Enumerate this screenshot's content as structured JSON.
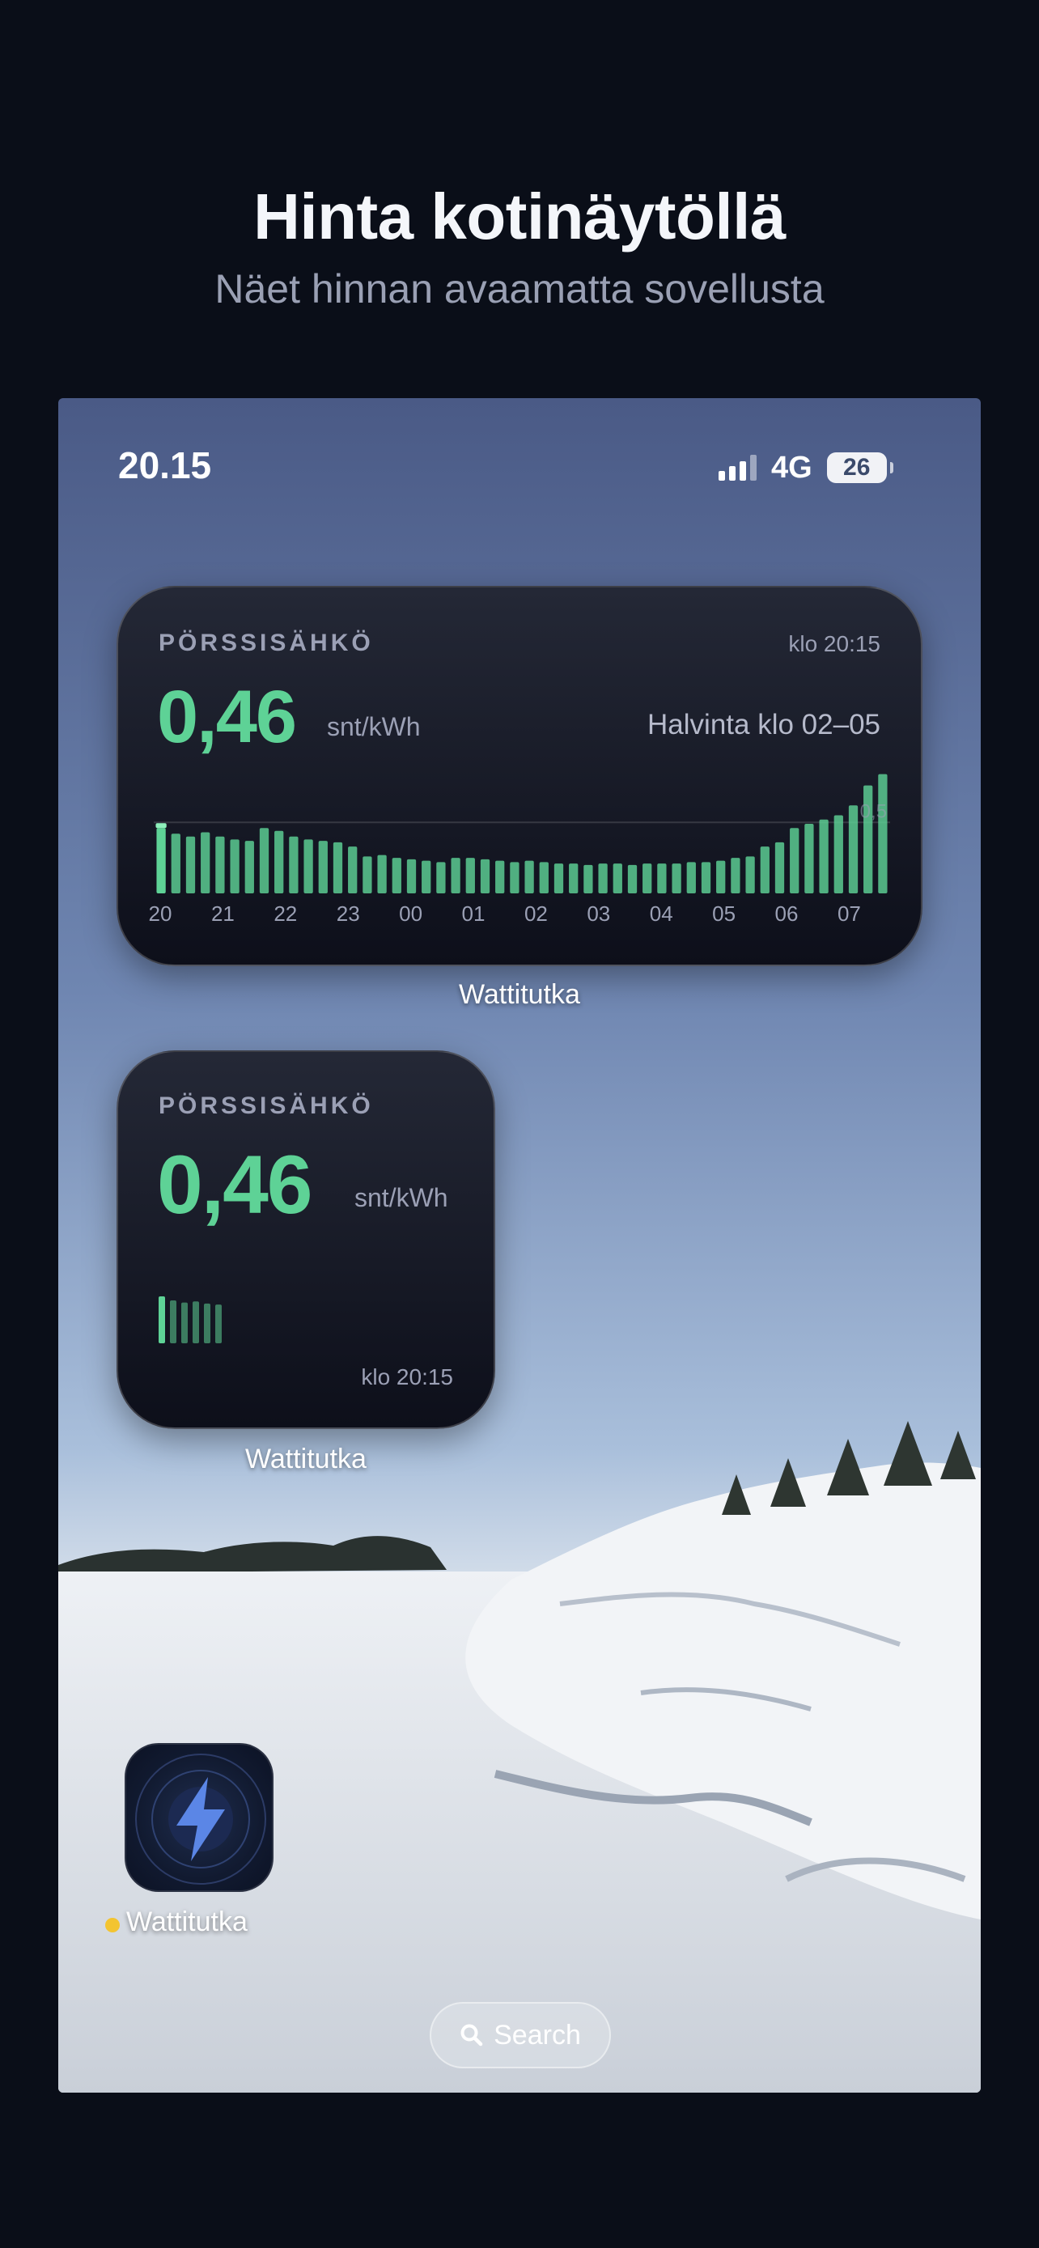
{
  "hero": {
    "title": "Hinta kotinäytöllä",
    "subtitle": "Näet hinnan avaamatta sovellusta"
  },
  "status_bar": {
    "time": "20.15",
    "network": "4G",
    "battery": "26"
  },
  "widget_large": {
    "label": "PÖRSSISÄHKÖ",
    "time": "klo 20:15",
    "price": "0,46",
    "unit": "snt/kWh",
    "cheapest": "Halvinta klo 02–05",
    "app_name": "Wattitutka"
  },
  "widget_small": {
    "label": "PÖRSSISÄHKÖ",
    "price": "0,46",
    "unit": "snt/kWh",
    "time": "klo 20:15",
    "app_name": "Wattitutka",
    "mini_values": [
      0.46,
      0.42,
      0.4,
      0.41,
      0.39,
      0.38
    ]
  },
  "app_icon": {
    "name": "Wattitutka",
    "icon": "lightning-bolt-icon"
  },
  "search": {
    "label": "Search",
    "icon": "search-icon"
  },
  "colors": {
    "accent_green": "#5ed296",
    "background": "#0a0e18",
    "muted_text": "#9ba0b5",
    "notification_dot": "#f3c431"
  },
  "chart_data": {
    "type": "bar",
    "tick_labels": [
      "20",
      "21",
      "22",
      "23",
      "00",
      "01",
      "02",
      "03",
      "04",
      "05",
      "06",
      "07"
    ],
    "reference_label": "0,5",
    "reference_value": 0.5,
    "ylim": [
      0,
      0.62
    ],
    "current_index": 0,
    "values": [
      0.46,
      0.42,
      0.4,
      0.43,
      0.4,
      0.38,
      0.37,
      0.46,
      0.44,
      0.4,
      0.38,
      0.37,
      0.36,
      0.33,
      0.26,
      0.27,
      0.25,
      0.24,
      0.23,
      0.22,
      0.25,
      0.25,
      0.24,
      0.23,
      0.22,
      0.23,
      0.22,
      0.21,
      0.21,
      0.2,
      0.21,
      0.21,
      0.2,
      0.21,
      0.21,
      0.21,
      0.22,
      0.22,
      0.23,
      0.25,
      0.26,
      0.33,
      0.36,
      0.46,
      0.49,
      0.52,
      0.55,
      0.62,
      0.76,
      0.84
    ]
  }
}
